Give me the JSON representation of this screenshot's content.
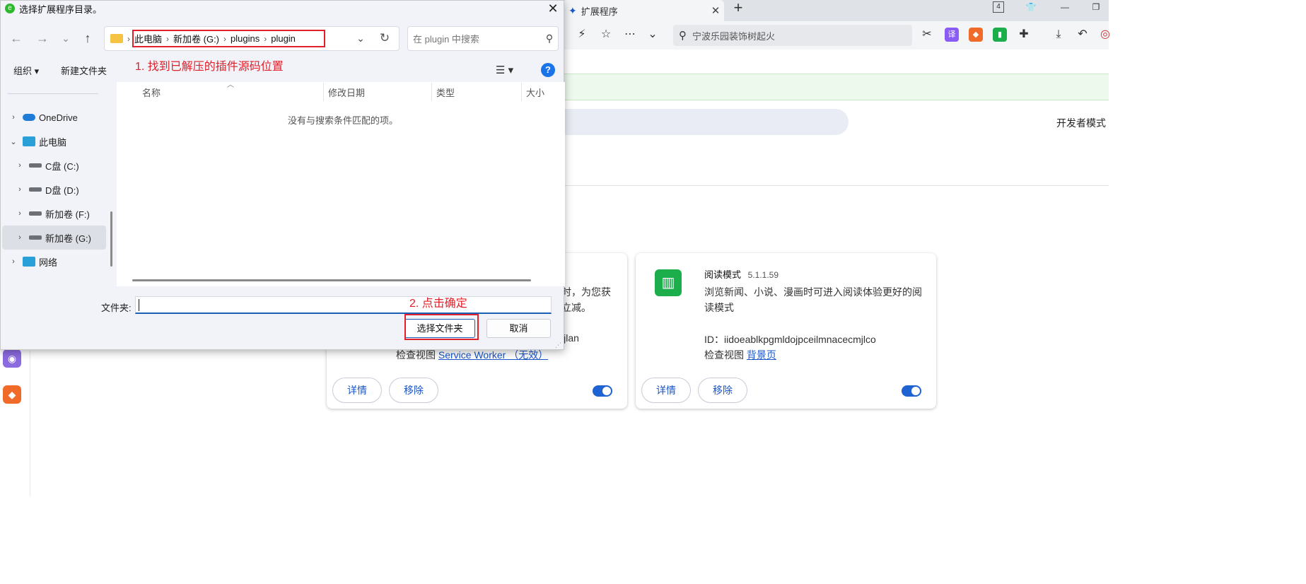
{
  "dialog": {
    "title": "选择扩展程序目录。",
    "close_glyph": "✕",
    "nav": {
      "back": "←",
      "forward": "→",
      "dropdown": "⌄",
      "up": "↑"
    },
    "breadcrumb": [
      "此电脑",
      "新加卷 (G:)",
      "plugins",
      "plugin"
    ],
    "search_placeholder": "在 plugin 中搜索",
    "toolbar": {
      "organize": "组织 ▾",
      "new_folder": "新建文件夹"
    },
    "annotation_1": "1. 找到已解压的插件源码位置",
    "annotation_2": "2. 点击确定",
    "nav_pane": [
      {
        "label": "OneDrive",
        "expanded": false
      },
      {
        "label": "此电脑",
        "expanded": true
      },
      {
        "label": "C盘 (C:)",
        "expanded": false
      },
      {
        "label": "D盘 (D:)",
        "expanded": false
      },
      {
        "label": "新加卷 (F:)",
        "expanded": false
      },
      {
        "label": "新加卷 (G:)",
        "expanded": false,
        "selected": true
      },
      {
        "label": "网络",
        "expanded": false
      }
    ],
    "columns": [
      "名称",
      "修改日期",
      "类型",
      "大小"
    ],
    "empty_message": "没有与搜索条件匹配的项。",
    "folder_label": "文件夹:",
    "folder_value": "",
    "ok_label": "选择文件夹",
    "cancel_label": "取消"
  },
  "browser": {
    "tab_title": "扩展程序",
    "tab_count": "4",
    "search_text": "宁波乐园装饰树起火",
    "dev_mode_label": "开发者模式",
    "card_left": {
      "desc_line1": "时，为您获",
      "desc_line2": "立减。",
      "id_fragment": "ijlan",
      "inspect_label": "检查视图",
      "inspect_link": "Service Worker （无效）",
      "details_label": "详情",
      "remove_label": "移除",
      "enabled": true
    },
    "card_right": {
      "name": "阅读模式",
      "version": "5.1.1.59",
      "desc_line1": "浏览新闻、小说、漫画时可进入阅读体验更好的阅",
      "desc_line2": "读模式",
      "id_line": "ID：iidoeablkpgmldojpceilmnacecmjlco",
      "inspect_label": "检查视图",
      "inspect_link": "背景页",
      "details_label": "详情",
      "remove_label": "移除",
      "enabled": true
    }
  },
  "colors": {
    "accent": "#1a5fb4",
    "annotation": "#e0202a",
    "toggle": "#1f62d1",
    "reader_icon": "#1cae4b"
  }
}
